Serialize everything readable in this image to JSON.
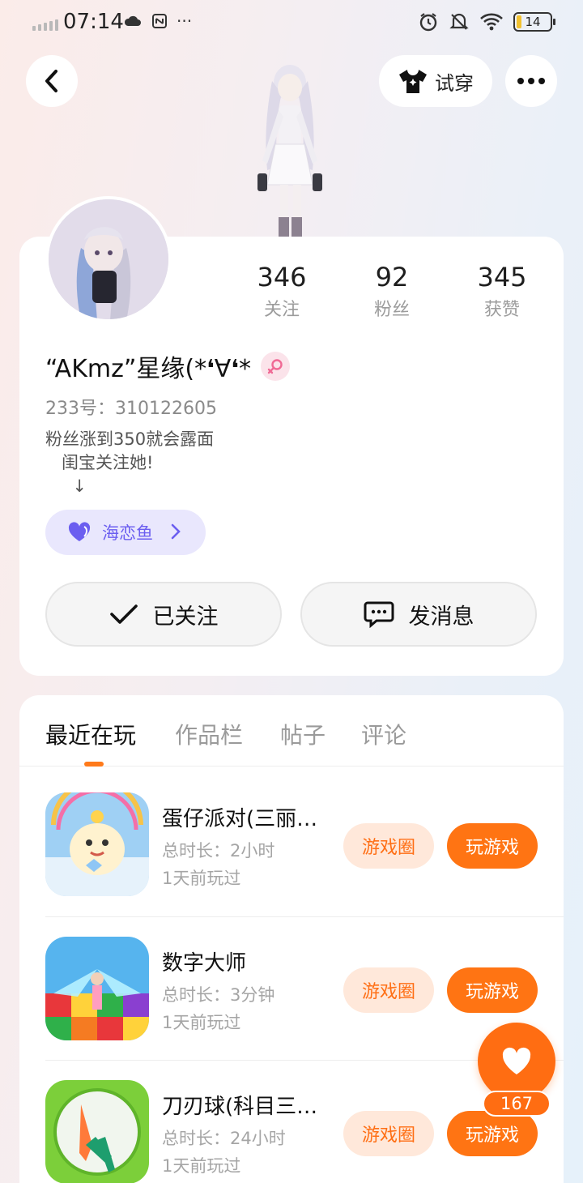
{
  "status_bar": {
    "time": "07:14",
    "battery": "14"
  },
  "header": {
    "try_on_label": "试穿",
    "back_icon": "chevron-left-icon",
    "more_icon": "more-horizontal-icon",
    "try_on_icon": "tshirt-icon"
  },
  "profile": {
    "stats": [
      {
        "value": "346",
        "label": "关注"
      },
      {
        "value": "92",
        "label": "粉丝"
      },
      {
        "value": "345",
        "label": "获赞"
      }
    ],
    "nickname": "“AKmz”星缘(*❛∀❛*",
    "uid": "233号：310122605",
    "bio": "粉丝涨到350就会露面\n   闺宝关注她!\n     ↓",
    "club_label": "海恋鱼",
    "follow_label": "已关注",
    "message_label": "发消息"
  },
  "tabs": [
    "最近在玩",
    "作品栏",
    "帖子",
    "评论"
  ],
  "games": [
    {
      "name": "蛋仔派对(三丽…",
      "duration": "总时长：2小时",
      "last_played": "1天前玩过",
      "circle_label": "游戏圈",
      "play_label": "玩游戏"
    },
    {
      "name": "数字大师",
      "duration": "总时长：3分钟",
      "last_played": "1天前玩过",
      "circle_label": "游戏圈",
      "play_label": "玩游戏"
    },
    {
      "name": "刀刃球(科目三…",
      "duration": "总时长：24小时",
      "last_played": "1天前玩过",
      "circle_label": "游戏圈",
      "play_label": "玩游戏"
    }
  ],
  "floating": {
    "like_count": "167"
  },
  "colors": {
    "accent": "#ff7413",
    "club": "#6b5ef0",
    "club_bg": "#e9e7fd"
  }
}
